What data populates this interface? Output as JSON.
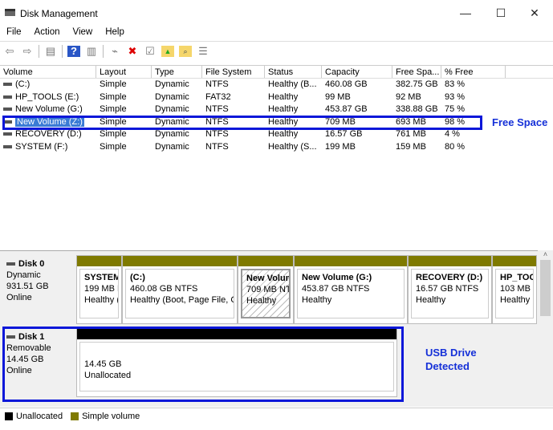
{
  "window": {
    "title": "Disk Management",
    "minimize": "—",
    "maximize": "☐",
    "close": "✕"
  },
  "menu": [
    "File",
    "Action",
    "View",
    "Help"
  ],
  "toolbar": [
    {
      "icon": "back-icon",
      "g": "⇦"
    },
    {
      "icon": "forward-icon",
      "g": "⇨"
    },
    {
      "icon": "show-pane-icon",
      "g": "▤"
    },
    {
      "icon": "help-icon",
      "g": "?"
    },
    {
      "icon": "console-icon",
      "g": "▥"
    },
    {
      "icon": "connect-disk-icon",
      "g": "⌁"
    },
    {
      "icon": "delete-icon",
      "g": "✖"
    },
    {
      "icon": "properties-icon",
      "g": "☑"
    },
    {
      "icon": "folder-up-icon",
      "g": "▲"
    },
    {
      "icon": "find-icon",
      "g": "⌕"
    },
    {
      "icon": "list-icon",
      "g": "☰"
    }
  ],
  "table": {
    "columns": [
      "Volume",
      "Layout",
      "Type",
      "File System",
      "Status",
      "Capacity",
      "Free Spa...",
      "% Free"
    ],
    "rows": [
      [
        "(C:)",
        "Simple",
        "Dynamic",
        "NTFS",
        "Healthy (B...",
        "460.08 GB",
        "382.75 GB",
        "83 %"
      ],
      [
        "HP_TOOLS (E:)",
        "Simple",
        "Dynamic",
        "FAT32",
        "Healthy",
        "99 MB",
        "92 MB",
        "93 %"
      ],
      [
        "New Volume (G:)",
        "Simple",
        "Dynamic",
        "NTFS",
        "Healthy",
        "453.87 GB",
        "338.88 GB",
        "75 %"
      ],
      [
        "New Volume (Z:)",
        "Simple",
        "Dynamic",
        "NTFS",
        "Healthy",
        "709 MB",
        "693 MB",
        "98 %"
      ],
      [
        "RECOVERY (D:)",
        "Simple",
        "Dynamic",
        "NTFS",
        "Healthy",
        "16.57 GB",
        "761 MB",
        "4 %"
      ],
      [
        "SYSTEM (F:)",
        "Simple",
        "Dynamic",
        "NTFS",
        "Healthy (S...",
        "199 MB",
        "159 MB",
        "80 %"
      ]
    ],
    "selected_row": 3
  },
  "annotations": {
    "free_space": "Free Space",
    "usb1": "USB Drive",
    "usb2": "Detected"
  },
  "disks": [
    {
      "name": "Disk 0",
      "type": "Dynamic",
      "size": "931.51 GB",
      "status": "Online",
      "partitions": [
        {
          "name": "SYSTEM",
          "size": "199 MB N",
          "status": "Healthy ("
        },
        {
          "name": "(C:)",
          "size": "460.08 GB NTFS",
          "status": "Healthy (Boot, Page File, C"
        },
        {
          "name": "New Volum",
          "size": "709 MB NTF",
          "status": "Healthy"
        },
        {
          "name": "New Volume  (G:)",
          "size": "453.87 GB NTFS",
          "status": "Healthy"
        },
        {
          "name": "RECOVERY  (D:)",
          "size": "16.57 GB NTFS",
          "status": "Healthy"
        },
        {
          "name": "HP_TOC",
          "size": "103 MB",
          "status": "Healthy"
        }
      ]
    },
    {
      "name": "Disk 1",
      "type": "Removable",
      "size": "14.45 GB",
      "status": "Online",
      "partitions": [
        {
          "size": "14.45 GB",
          "status": "Unallocated"
        }
      ]
    }
  ],
  "legend": [
    {
      "label": "Unallocated",
      "color": "#000000"
    },
    {
      "label": "Simple volume",
      "color": "#7f7a00"
    }
  ],
  "colors": {
    "highlight": "#0b17d9",
    "simple": "#7f7a00",
    "unallocated": "#000000"
  }
}
